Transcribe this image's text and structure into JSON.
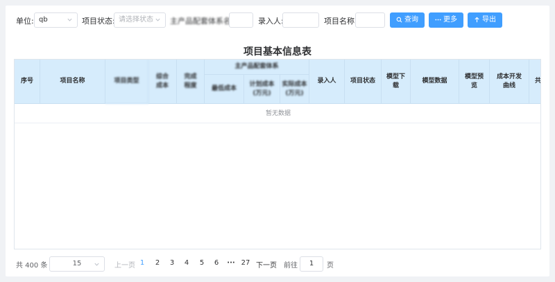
{
  "filters": {
    "unit_label": "单位:",
    "unit_value": "qb",
    "status_label": "项目状态:",
    "status_placeholder": "请选择状态",
    "system_label": "主产品配套体系名称:",
    "entry_label": "录入人:",
    "name_label": "项目名称:"
  },
  "buttons": {
    "query": "查询",
    "more": "更多",
    "export": "导出"
  },
  "table": {
    "title": "项目基本信息表",
    "headers": {
      "index": "序号",
      "name": "项目名称",
      "project_type": "项目类型",
      "overall": "综合\n成本",
      "degree": "完成\n程度",
      "group": "主产品配套体系",
      "sub1": "最低成本",
      "sub2": "计划成本\n(万元)",
      "sub3": "实际成本\n(万元)",
      "entry": "录入人",
      "status": "项目状态",
      "model_download": "模型下\n载",
      "model_data": "模型数据",
      "model_preview": "模型预\n览",
      "curve": "成本开发\n曲线",
      "more_col": "共"
    },
    "empty_text": "暂无数据"
  },
  "pagination": {
    "total": "共 400 条",
    "page_size": "15",
    "prev": "上一页",
    "pages": [
      "1",
      "2",
      "3",
      "4",
      "5",
      "6",
      "···",
      "27"
    ],
    "current": "1",
    "next": "下一页",
    "goto_label": "前往",
    "goto_value": "1",
    "page_unit": "页"
  },
  "colors": {
    "primary": "#409eff",
    "header_bg": "#d6ecfc",
    "page_bg": "#f0f2f5"
  }
}
